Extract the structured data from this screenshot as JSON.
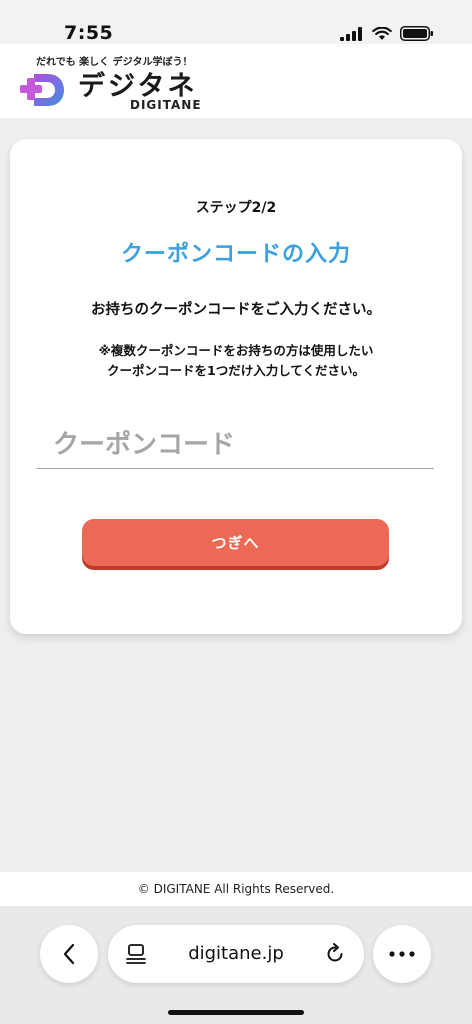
{
  "status_bar": {
    "time": "7:55"
  },
  "header": {
    "tagline": "だれでも 楽しく デジタル学ぼう！",
    "logo_name": "デジタネ",
    "logo_sub": "DIGITANE"
  },
  "card": {
    "step": "ステップ2/2",
    "title": "クーポンコードの入力",
    "instruction": "お持ちのクーポンコードをご入力ください。",
    "note_line1": "※複数クーポンコードをお持ちの方は使用したい",
    "note_line2": "クーポンコードを1つだけ入力してください。",
    "input_placeholder": "クーポンコード",
    "input_value": "",
    "next_label": "つぎへ"
  },
  "footer": {
    "copyright": "© DIGITANE All Rights Reserved."
  },
  "browser": {
    "url": "digitane.jp",
    "icons": {
      "back": "chevron-left-icon",
      "tabs": "tab-overview-icon",
      "reload": "reload-icon",
      "more": "more-icon"
    }
  },
  "colors": {
    "title": "#3aa0de",
    "button": "#ec6a55",
    "button_shadow": "#bd3d2a",
    "logo_gradient_start": "#b14fe0",
    "logo_gradient_end": "#3e8fe0"
  }
}
